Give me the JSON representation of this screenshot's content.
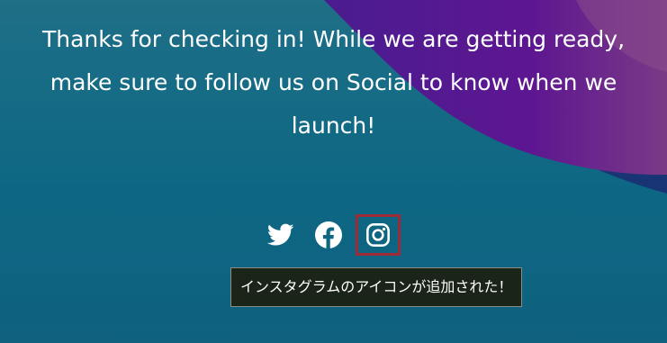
{
  "message": {
    "text": "Thanks for checking in! While we are getting ready, make sure to follow us on Social to know when we launch!"
  },
  "social": {
    "icons": [
      {
        "name": "twitter-icon"
      },
      {
        "name": "facebook-icon"
      },
      {
        "name": "instagram-icon",
        "highlighted": true
      }
    ],
    "highlight_color": "#9e2a36"
  },
  "tooltip": {
    "text": "インスタグラムのアイコンが追加された！"
  },
  "colors": {
    "background": "#0d6784",
    "accent_purple": "#5b1a8c",
    "text": "#ffffff"
  }
}
